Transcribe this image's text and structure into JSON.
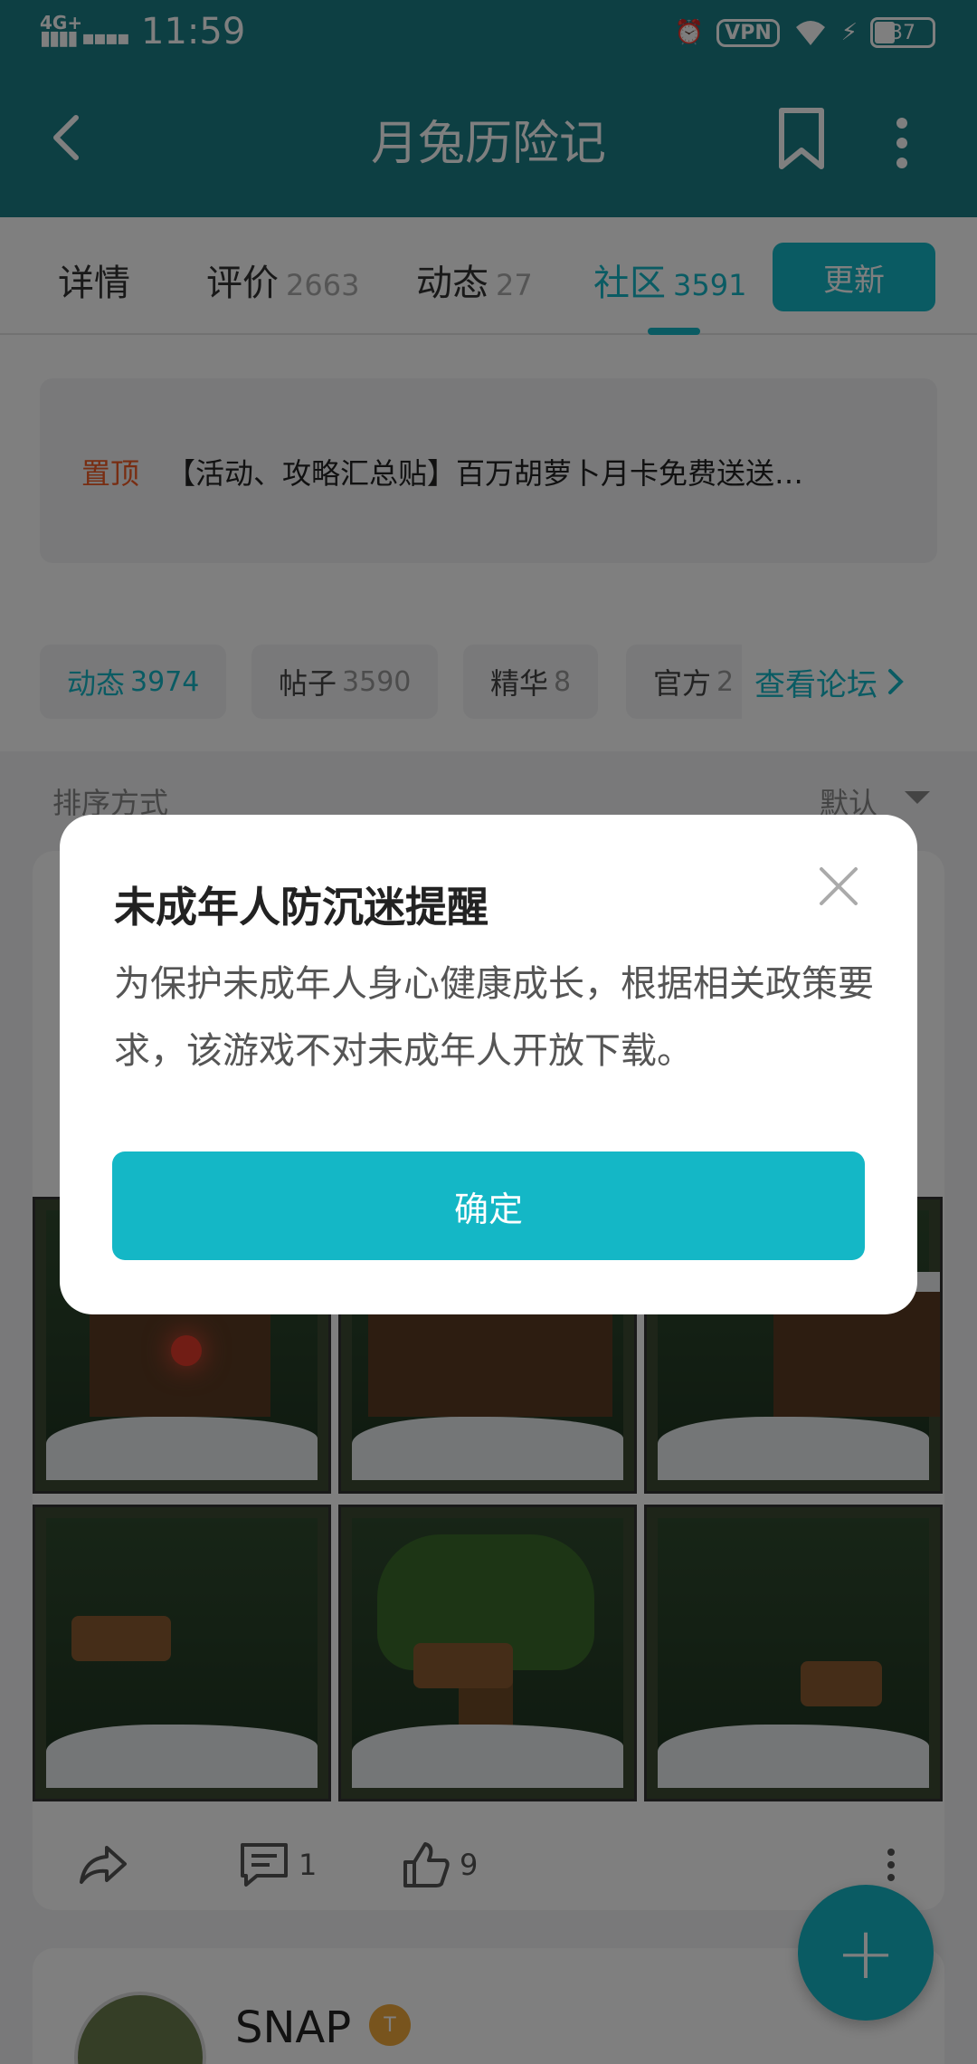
{
  "status_bar": {
    "network": "4G+",
    "time": "11:59",
    "vpn": "VPN",
    "battery": "37"
  },
  "app_bar": {
    "title": "月兔历险记"
  },
  "tabs": [
    {
      "label": "详情",
      "count": ""
    },
    {
      "label": "评价",
      "count": "2663"
    },
    {
      "label": "动态",
      "count": "27"
    },
    {
      "label": "社区",
      "count": "3591"
    }
  ],
  "update_button": "更新",
  "pinned": {
    "tag": "置顶",
    "text": "【活动、攻略汇总贴】百万胡萝卜月卡免费送送…"
  },
  "chips": [
    {
      "label": "动态",
      "count": "3974"
    },
    {
      "label": "帖子",
      "count": "3590"
    },
    {
      "label": "精华",
      "count": "8"
    },
    {
      "label": "官方",
      "count": "2"
    }
  ],
  "forum_link": "查看论坛",
  "sort": {
    "label": "排序方式",
    "value": "默认"
  },
  "post_actions": {
    "comments": "1",
    "likes": "9"
  },
  "next_post": {
    "username": "SNAP",
    "level": "T"
  },
  "dialog": {
    "title": "未成年人防沉迷提醒",
    "body": "为保护未成年人身心健康成长，根据相关政策要求，该游戏不对未成年人开放下载。",
    "confirm": "确定"
  },
  "colors": {
    "accent": "#14b7c6",
    "header": "#1a7f87",
    "pinned_tag": "#f15a24"
  }
}
